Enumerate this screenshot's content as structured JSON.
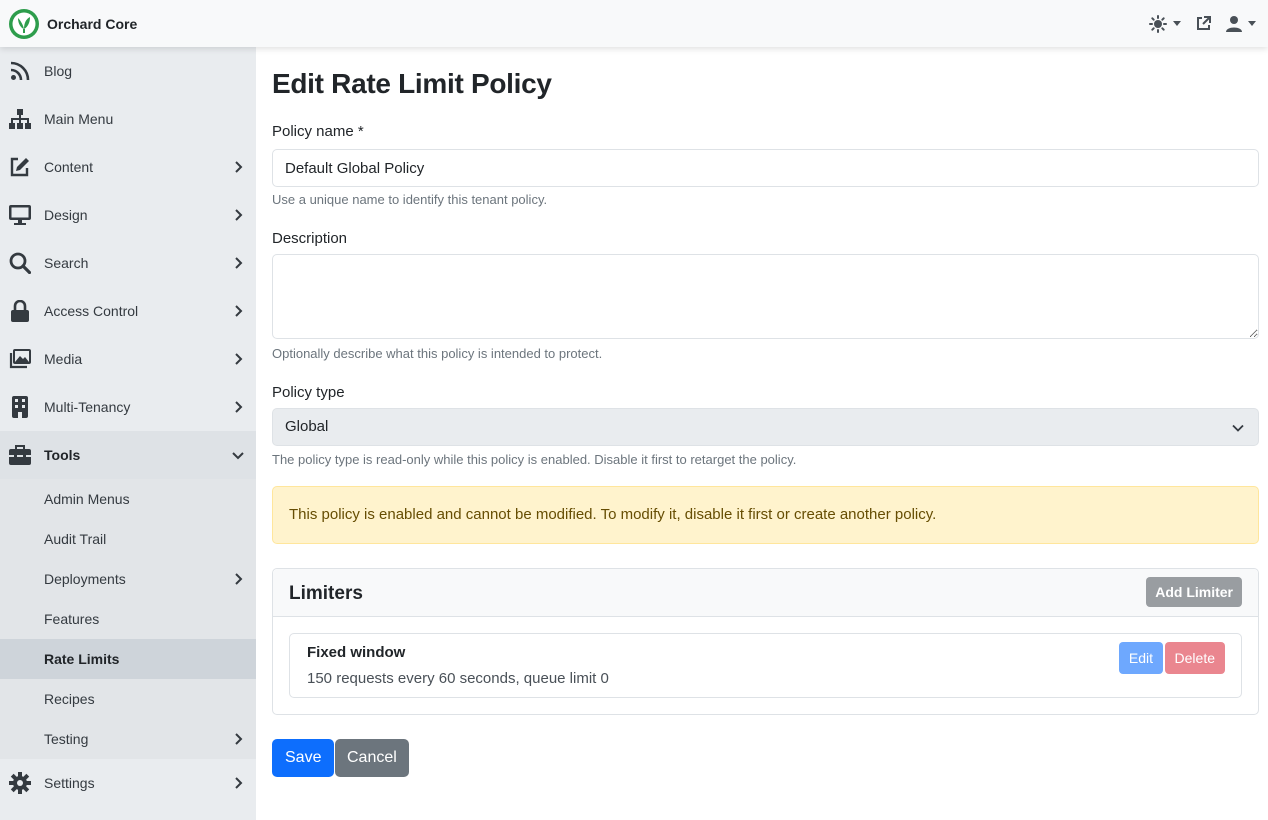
{
  "app": {
    "brand_name": "Orchard Core"
  },
  "sidebar": {
    "items": [
      {
        "label": "Blog",
        "icon": "rss-icon"
      },
      {
        "label": "Main Menu",
        "icon": "sitemap-icon"
      },
      {
        "label": "Content",
        "icon": "edit-icon"
      },
      {
        "label": "Design",
        "icon": "monitor-icon"
      },
      {
        "label": "Search",
        "icon": "search-icon"
      },
      {
        "label": "Access Control",
        "icon": "lock-icon"
      },
      {
        "label": "Media",
        "icon": "images-icon"
      },
      {
        "label": "Multi-Tenancy",
        "icon": "building-icon"
      },
      {
        "label": "Tools",
        "icon": "toolbox-icon"
      },
      {
        "label": "Settings",
        "icon": "gear-icon"
      }
    ],
    "tools_children": [
      {
        "label": "Admin Menus"
      },
      {
        "label": "Audit Trail"
      },
      {
        "label": "Deployments"
      },
      {
        "label": "Features"
      },
      {
        "label": "Rate Limits"
      },
      {
        "label": "Recipes"
      },
      {
        "label": "Testing"
      }
    ]
  },
  "form": {
    "title": "Edit Rate Limit Policy",
    "policy_name_label": "Policy name *",
    "policy_name_value": "Default Global Policy",
    "policy_name_help": "Use a unique name to identify this tenant policy.",
    "description_label": "Description",
    "description_value": "",
    "description_help": "Optionally describe what this policy is intended to protect.",
    "policy_type_label": "Policy type",
    "policy_type_value": "Global",
    "policy_type_help": "The policy type is read-only while this policy is enabled. Disable it first to retarget the policy.",
    "alert_text": "This policy is enabled and cannot be modified. To modify it, disable it first or create another policy."
  },
  "limiters": {
    "title": "Limiters",
    "add_label": "Add Limiter",
    "items": [
      {
        "name": "Fixed window",
        "description": "150 requests every 60 seconds, queue limit 0",
        "edit_label": "Edit",
        "delete_label": "Delete"
      }
    ]
  },
  "actions": {
    "save_label": "Save",
    "cancel_label": "Cancel"
  },
  "colors": {
    "primary": "#0d6efd",
    "secondary": "#6c757d",
    "alert_bg": "#fff3cd",
    "alert_text": "#664d03",
    "brand_green": "#2e9d4c"
  }
}
